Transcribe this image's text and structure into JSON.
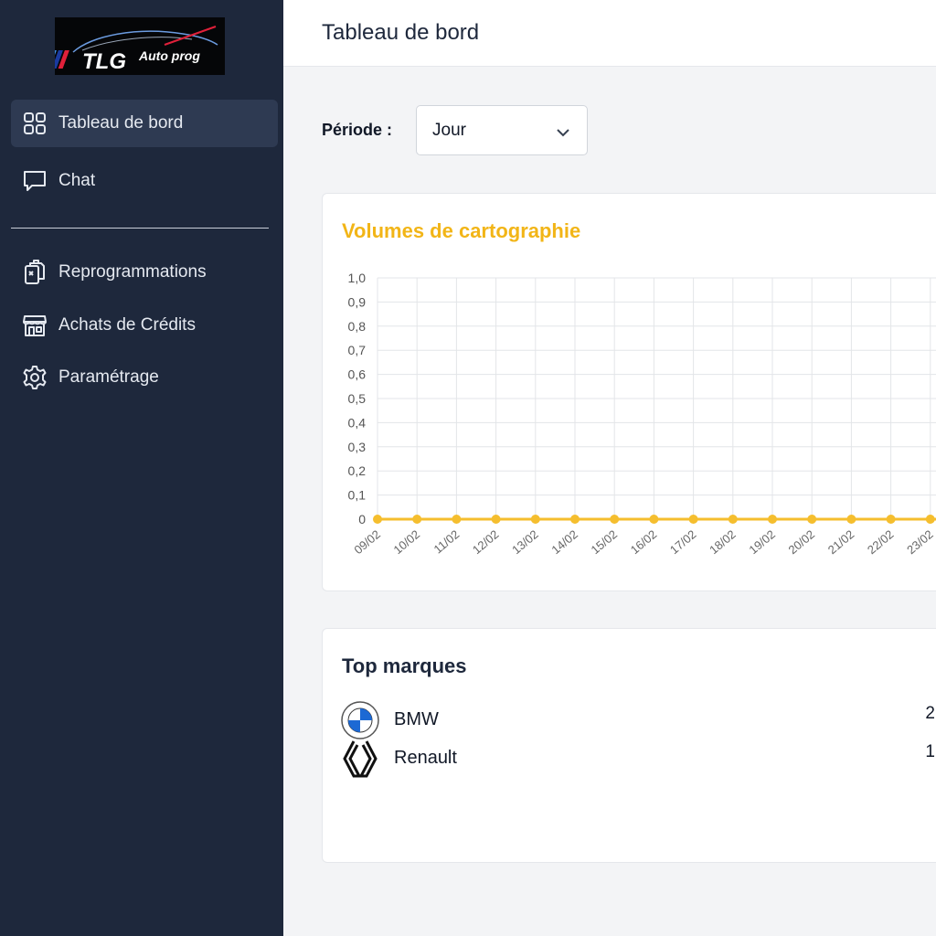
{
  "app": {
    "logo_text": "TLG",
    "logo_sub": "Auto prog"
  },
  "sidebar": {
    "items": [
      {
        "label": "Tableau de bord",
        "icon": "grid-icon",
        "active": true
      },
      {
        "label": "Chat",
        "icon": "chat-icon"
      },
      {
        "label": "Reprogrammations",
        "icon": "clipboard-icon"
      },
      {
        "label": "Achats de Crédits",
        "icon": "store-icon"
      },
      {
        "label": "Paramétrage",
        "icon": "gear-icon"
      }
    ]
  },
  "header": {
    "title": "Tableau de bord"
  },
  "filters": {
    "period_label": "Période :",
    "period_value": "Jour"
  },
  "chart_card": {
    "title": "Volumes de cartographie"
  },
  "chart_data": {
    "type": "line",
    "title": "Volumes de cartographie",
    "categories": [
      "09/02",
      "10/02",
      "11/02",
      "12/02",
      "13/02",
      "14/02",
      "15/02",
      "16/02",
      "17/02",
      "18/02",
      "19/02",
      "20/02",
      "21/02",
      "22/02",
      "23/02"
    ],
    "series": [
      {
        "values": [
          0,
          0,
          0,
          0,
          0,
          0,
          0,
          0,
          0,
          0,
          0,
          0,
          0,
          0,
          0
        ],
        "color": "#f5be2e"
      }
    ],
    "ylim": [
      0,
      1.0
    ],
    "yticks": [
      "0",
      "0,1",
      "0,2",
      "0,3",
      "0,4",
      "0,5",
      "0,6",
      "0,7",
      "0,8",
      "0,9",
      "1,0"
    ],
    "grid": true
  },
  "brands_card": {
    "title": "Top marques",
    "rows": [
      {
        "name": "BMW",
        "count": "2",
        "logo": "bmw-logo"
      },
      {
        "name": "Renault",
        "count": "1",
        "logo": "renault-logo"
      }
    ]
  },
  "colors": {
    "sidebar_bg": "#1e283c",
    "accent": "#f2b517",
    "line": "#f5be2e"
  }
}
